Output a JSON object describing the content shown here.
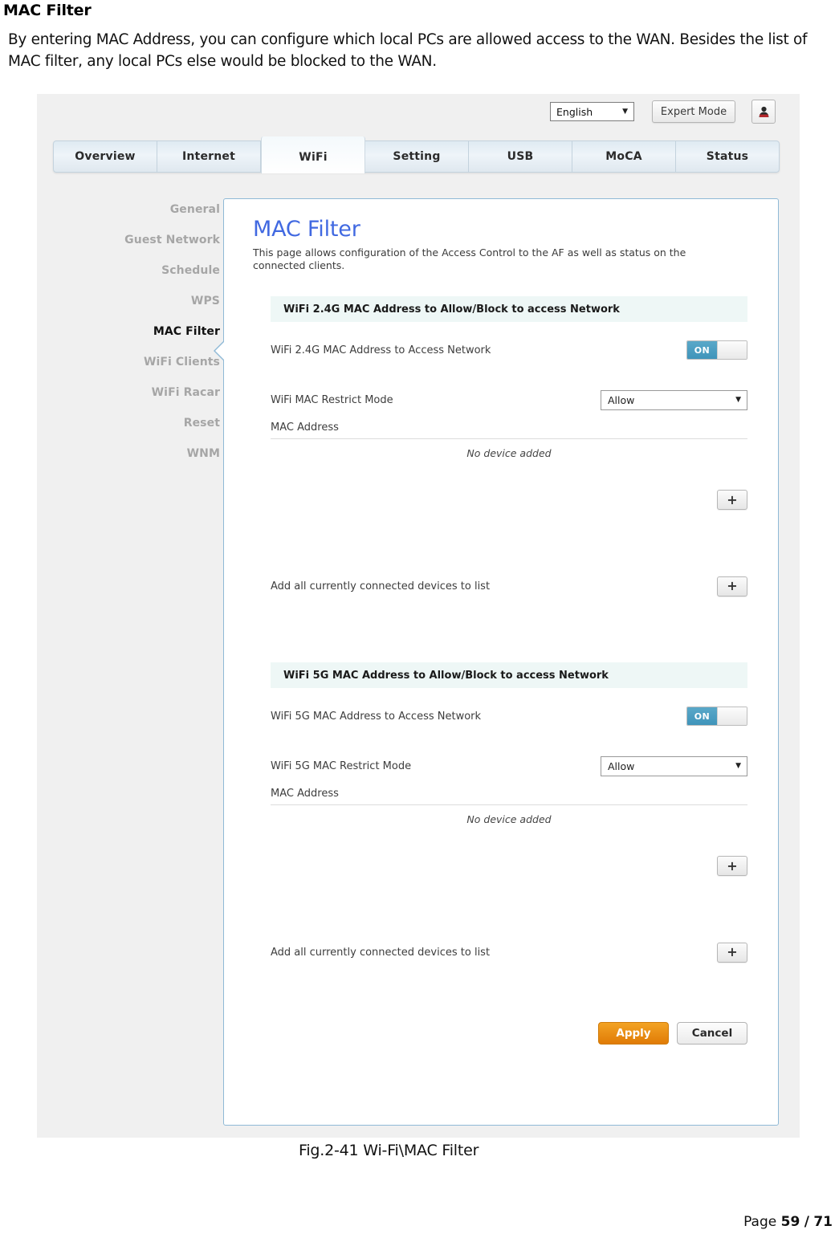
{
  "document": {
    "heading": "MAC Filter",
    "paragraph": "By entering MAC Address, you can configure which local PCs are allowed access to the WAN. Besides the list of MAC filter, any local PCs else would be blocked to the WAN.",
    "figure_caption": "Fig.2-41 Wi-Fi\\MAC Filter",
    "footer_prefix": "Page",
    "footer_page": "59",
    "footer_sep": "/",
    "footer_total": "71"
  },
  "header": {
    "language_value": "English",
    "expert_mode_label": "Expert Mode",
    "user_icon": "user-account-icon",
    "caret_glyph": "▼"
  },
  "nav": {
    "tabs": [
      {
        "label": "Overview",
        "active": false
      },
      {
        "label": "Internet",
        "active": false
      },
      {
        "label": "WiFi",
        "active": true
      },
      {
        "label": "Setting",
        "active": false
      },
      {
        "label": "USB",
        "active": false
      },
      {
        "label": "MoCA",
        "active": false
      },
      {
        "label": "Status",
        "active": false
      }
    ]
  },
  "sidebar": {
    "items": [
      {
        "label": "General",
        "active": false
      },
      {
        "label": "Guest Network",
        "active": false
      },
      {
        "label": "Schedule",
        "active": false
      },
      {
        "label": "WPS",
        "active": false
      },
      {
        "label": "MAC Filter",
        "active": true
      },
      {
        "label": "WiFi Clients",
        "active": false
      },
      {
        "label": "WiFi Racar",
        "active": false
      },
      {
        "label": "Reset",
        "active": false
      },
      {
        "label": "WNM",
        "active": false
      }
    ]
  },
  "page": {
    "title": "MAC Filter",
    "description": "This page allows configuration of the Access Control to the AF as well as status on the connected clients."
  },
  "section_24g": {
    "header": "WiFi 2.4G MAC Address to Allow/Block to access Network",
    "access_label": "WiFi 2.4G MAC Address to Access Network",
    "access_toggle_state": "ON",
    "restrict_label": "WiFi MAC Restrict Mode",
    "restrict_value": "Allow",
    "mac_list_label": "MAC Address",
    "empty_note": "No device added",
    "add_entry_button": "+",
    "add_all_label": "Add all currently connected devices to list",
    "add_all_button": "+"
  },
  "section_5g": {
    "header": "WiFi 5G MAC Address to Allow/Block to access Network",
    "access_label": "WiFi 5G MAC Address to Access Network",
    "access_toggle_state": "ON",
    "restrict_label": "WiFi 5G MAC Restrict Mode",
    "restrict_value": "Allow",
    "mac_list_label": "MAC Address",
    "empty_note": "No device added",
    "add_entry_button": "+",
    "add_all_label": "Add all currently connected devices to list",
    "add_all_button": "+"
  },
  "actions": {
    "apply_label": "Apply",
    "cancel_label": "Cancel"
  },
  "colors": {
    "title_blue": "#4169e1",
    "section_band": "#eef7f6",
    "toggle_on": "#3f94ba",
    "apply_orange": "#e07b06",
    "panel_border": "#8fb9d6",
    "page_bg": "#f0f0f0"
  }
}
